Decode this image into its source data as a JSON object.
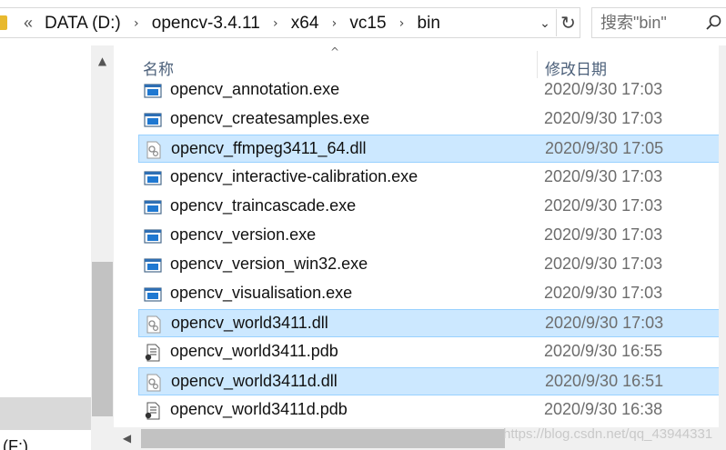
{
  "address": {
    "leading_chevron": "«",
    "crumbs": [
      "DATA (D:)",
      "opencv-3.4.11",
      "x64",
      "vc15",
      "bin"
    ],
    "separator": "›",
    "dropdown_icon": "chevron-down-icon",
    "refresh_icon": "refresh-icon"
  },
  "search": {
    "placeholder": "搜索\"bin\""
  },
  "nav": {
    "drive_label": "(F:)"
  },
  "columns": {
    "name": "名称",
    "date": "修改日期",
    "sort_caret": "^"
  },
  "files": [
    {
      "name": "opencv_annotation.exe",
      "date": "2020/9/30 17:03",
      "type": "exe",
      "selected": false
    },
    {
      "name": "opencv_createsamples.exe",
      "date": "2020/9/30 17:03",
      "type": "exe",
      "selected": false
    },
    {
      "name": "opencv_ffmpeg3411_64.dll",
      "date": "2020/9/30 17:05",
      "type": "dll",
      "selected": true
    },
    {
      "name": "opencv_interactive-calibration.exe",
      "date": "2020/9/30 17:03",
      "type": "exe",
      "selected": false
    },
    {
      "name": "opencv_traincascade.exe",
      "date": "2020/9/30 17:03",
      "type": "exe",
      "selected": false
    },
    {
      "name": "opencv_version.exe",
      "date": "2020/9/30 17:03",
      "type": "exe",
      "selected": false
    },
    {
      "name": "opencv_version_win32.exe",
      "date": "2020/9/30 17:03",
      "type": "exe",
      "selected": false
    },
    {
      "name": "opencv_visualisation.exe",
      "date": "2020/9/30 17:03",
      "type": "exe",
      "selected": false
    },
    {
      "name": "opencv_world3411.dll",
      "date": "2020/9/30 17:03",
      "type": "dll",
      "selected": true
    },
    {
      "name": "opencv_world3411.pdb",
      "date": "2020/9/30 16:55",
      "type": "pdb",
      "selected": false
    },
    {
      "name": "opencv_world3411d.dll",
      "date": "2020/9/30 16:51",
      "type": "dll",
      "selected": true
    },
    {
      "name": "opencv_world3411d.pdb",
      "date": "2020/9/30 16:38",
      "type": "pdb",
      "selected": false
    }
  ],
  "watermark": "https://blog.csdn.net/qq_43944331",
  "colors": {
    "selection_bg": "#cce8ff",
    "selection_border": "#99d1ff",
    "header_text": "#4c607a",
    "date_text": "#6d6d6d"
  }
}
